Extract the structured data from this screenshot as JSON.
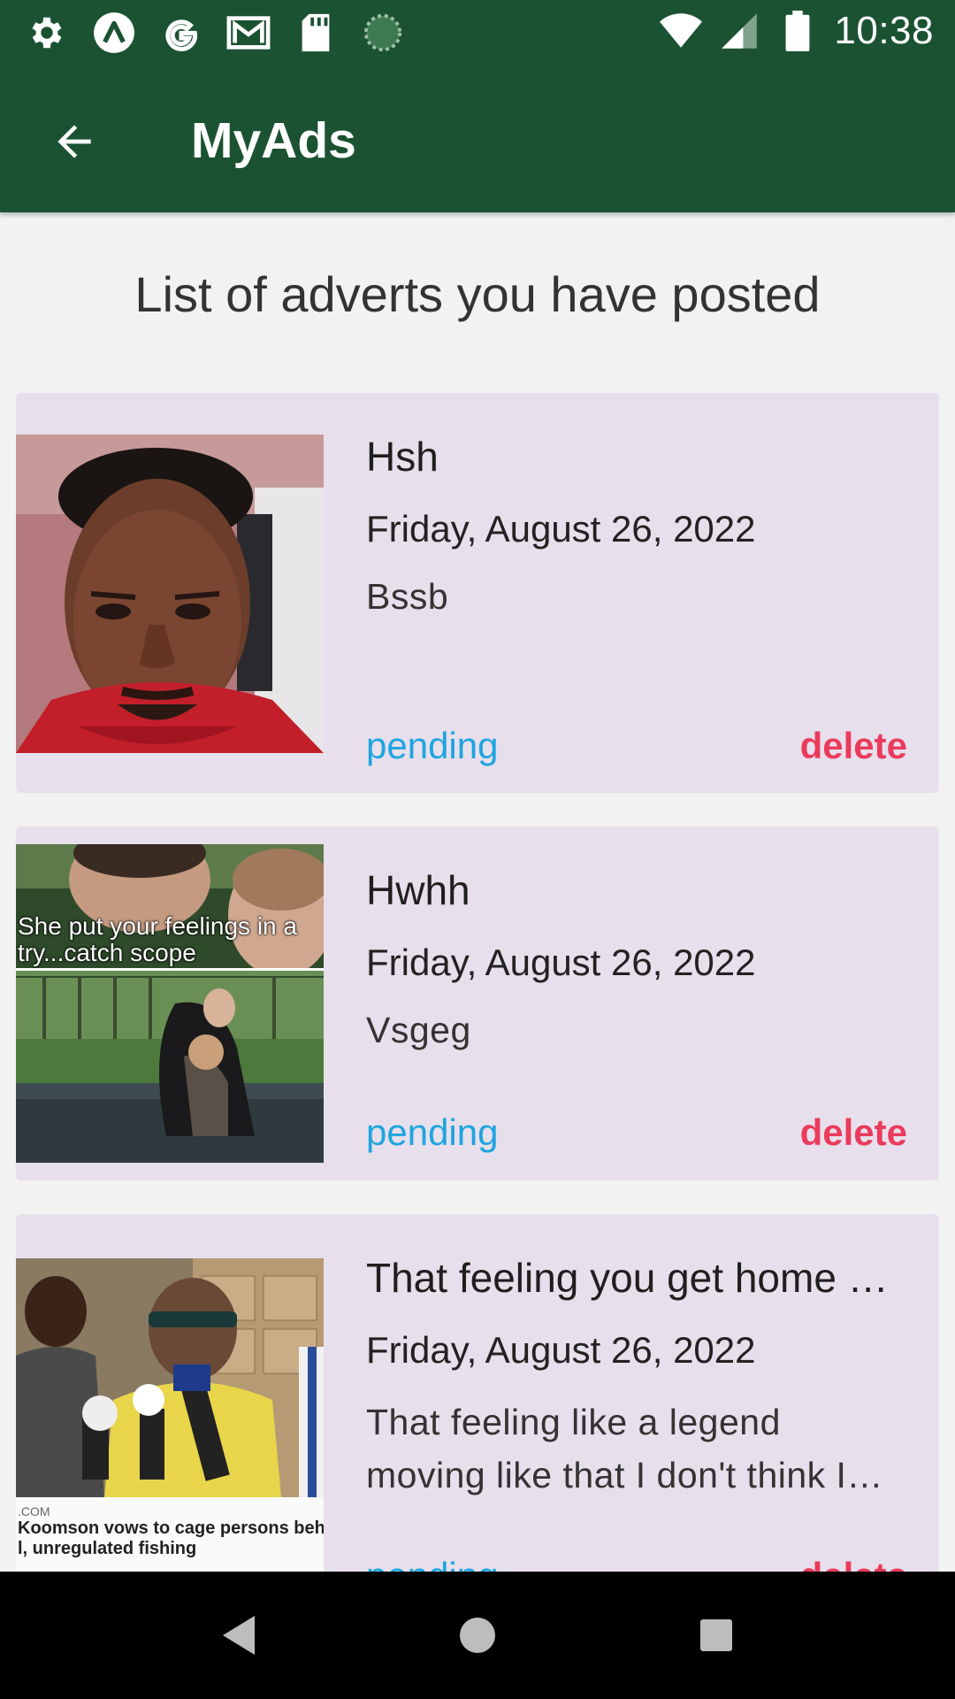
{
  "status_bar": {
    "time": "10:38",
    "left_icons": [
      "settings-icon",
      "arc-icon",
      "google-icon",
      "gmail-icon",
      "sd-card-icon",
      "loading-icon"
    ],
    "right_icons": [
      "wifi-icon",
      "cell-signal-icon",
      "battery-icon"
    ]
  },
  "app_bar": {
    "title": "MyAds",
    "back_icon": "arrow-back-icon",
    "color": "#1b5232"
  },
  "page_heading": "List of adverts you have posted",
  "ads": [
    {
      "title": "Hsh",
      "date": "Friday, August 26, 2022",
      "description": "Bssb",
      "status": "pending",
      "delete_label": "delete"
    },
    {
      "title": "Hwhh",
      "date": "Friday, August 26, 2022",
      "description": "Vsgeg",
      "status": "pending",
      "delete_label": "delete",
      "image_caption": "She put your feelings in a try...catch scope"
    },
    {
      "title": "That feeling you get home …",
      "date": "Friday, August 26, 2022",
      "description": "That feeling like a legend moving like that I don't think I…",
      "status": "pending",
      "delete_label": "delete",
      "image_source": ".COM",
      "image_headline_1": "Koomson vows to cage persons behind",
      "image_headline_2": "l, unregulated fishing"
    }
  ],
  "colors": {
    "status_pending": "#1ea5e0",
    "delete": "#ea3b5c",
    "card_bg": "#e7dfeb"
  },
  "nav_bar": {
    "icons": [
      "back-triangle-icon",
      "home-circle-icon",
      "recents-square-icon"
    ]
  }
}
